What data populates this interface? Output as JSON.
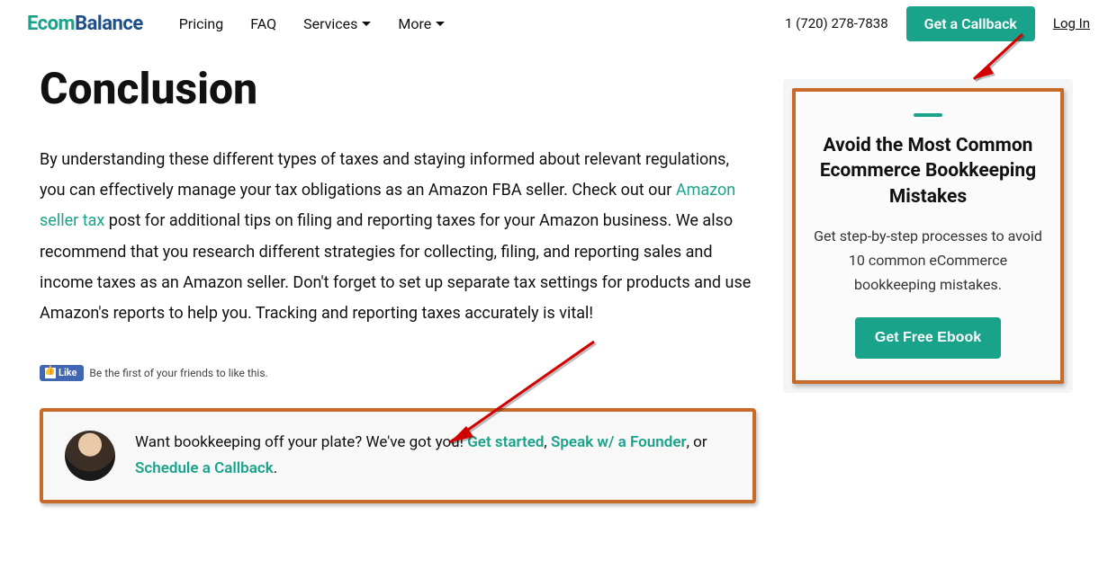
{
  "header": {
    "logo_part1": "Ecom",
    "logo_part2": "Balance",
    "nav": {
      "pricing": "Pricing",
      "faq": "FAQ",
      "services": "Services",
      "more": "More"
    },
    "phone": "1 (720) 278-7838",
    "callback_btn": "Get a Callback",
    "login": "Log In"
  },
  "article": {
    "heading": "Conclusion",
    "p1_a": "By understanding these different types of taxes and staying informed about relevant regulations, you can effectively manage your tax obligations as an Amazon FBA seller. Check out our ",
    "p1_link": "Amazon seller tax",
    "p1_b": " post for additional tips on filing and reporting taxes for your Amazon business. We also recommend that you research different strategies for collecting, filing, and reporting sales and income taxes as an Amazon seller. Don't forget to set up separate tax settings for products and use Amazon's reports to help you. Tracking and reporting taxes accurately is vital!",
    "fb_like_btn": "Like",
    "fb_like_text": "Be the first of your friends to like this."
  },
  "cta": {
    "lead": "Want bookkeeping off your plate? We've got you! ",
    "get_started": "Get started",
    "sep1": ", ",
    "speak": "Speak w/ a Founder",
    "sep2": ", or ",
    "schedule": "Schedule a Callback",
    "tail": "."
  },
  "sidebar": {
    "title": "Avoid the Most Common Ecommerce Bookkeeping Mistakes",
    "desc": "Get step-by-step processes to avoid 10 common eCommerce bookkeeping mistakes.",
    "btn": "Get Free Ebook"
  }
}
